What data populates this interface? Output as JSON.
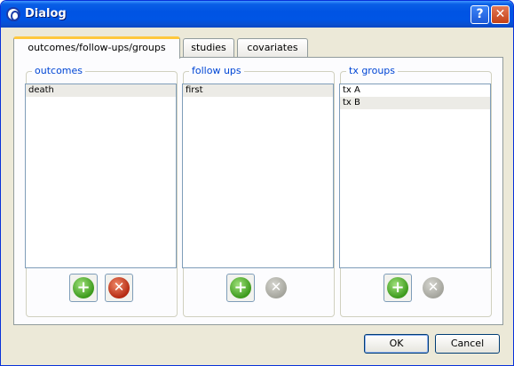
{
  "window": {
    "title": "Dialog",
    "help_glyph": "?",
    "close_glyph": "✕"
  },
  "tabs": [
    {
      "label": "outcomes/follow-ups/groups",
      "active": true
    },
    {
      "label": "studies",
      "active": false
    },
    {
      "label": "covariates",
      "active": false
    }
  ],
  "groups": {
    "outcomes": {
      "title": "outcomes",
      "items": [
        "death"
      ],
      "selected": 0,
      "remove_enabled": true
    },
    "follow_ups": {
      "title": "follow ups",
      "items": [
        "first"
      ],
      "selected": 0,
      "remove_enabled": false
    },
    "tx_groups": {
      "title": "tx groups",
      "items": [
        "tx A",
        "tx B"
      ],
      "selected": 1,
      "remove_enabled": false
    }
  },
  "icons": {
    "add": "+",
    "remove": "✕"
  },
  "buttons": {
    "ok": "OK",
    "cancel": "Cancel"
  },
  "colors": {
    "group_title": "#0046d5",
    "tab_highlight": "#ffc83c",
    "titlebar": "#0054e3"
  }
}
